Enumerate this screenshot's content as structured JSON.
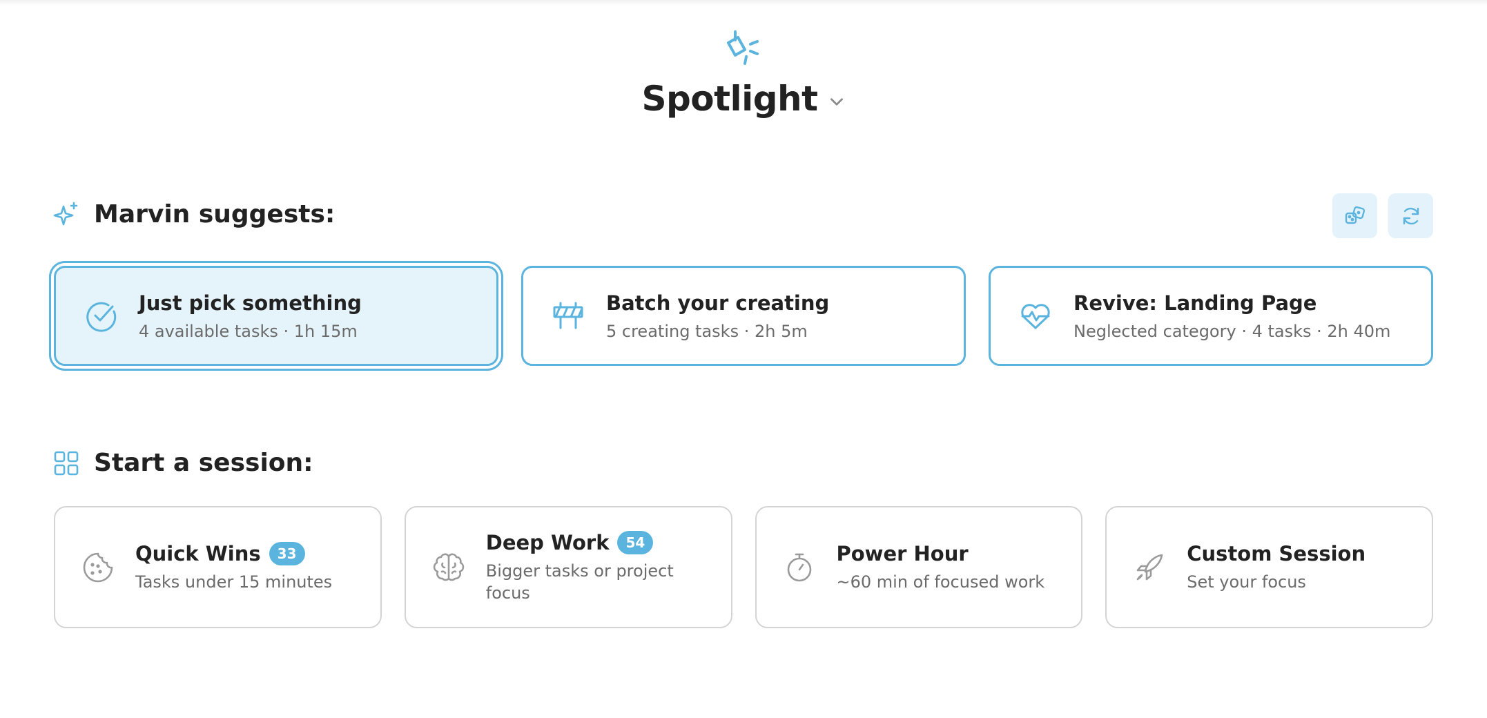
{
  "header": {
    "title": "Spotlight",
    "logo_icon": "spotlight-icon",
    "dropdown_icon": "chevron-down-icon"
  },
  "colors": {
    "accent": "#5ab4de",
    "accent_light": "#e5f3fa",
    "text": "#222222",
    "muted": "#6b6b6b",
    "border": "#d4d4d4"
  },
  "suggestions": {
    "heading": "Marvin suggests:",
    "heading_icon": "sparkles-icon",
    "tools": [
      "dice-icon",
      "refresh-icon"
    ],
    "cards": [
      {
        "title": "Just pick something",
        "subtitle": "4 available tasks · 1h 15m",
        "icon": "check-circle-icon",
        "selected": true
      },
      {
        "title": "Batch your creating",
        "subtitle": "5 creating tasks · 2h 5m",
        "icon": "barrier-icon",
        "selected": false
      },
      {
        "title": "Revive: Landing Page",
        "subtitle": "Neglected category · 4 tasks · 2h 40m",
        "icon": "heart-pulse-icon",
        "selected": false
      }
    ]
  },
  "sessions": {
    "heading": "Start a session:",
    "heading_icon": "grid-icon",
    "cards": [
      {
        "title": "Quick Wins",
        "badge": "33",
        "subtitle": "Tasks under 15 minutes",
        "icon": "cookie-icon"
      },
      {
        "title": "Deep Work",
        "badge": "54",
        "subtitle": "Bigger tasks or project focus",
        "icon": "brain-icon"
      },
      {
        "title": "Power Hour",
        "subtitle": "~60 min of focused work",
        "icon": "stopwatch-icon"
      },
      {
        "title": "Custom Session",
        "subtitle": "Set your focus",
        "icon": "rocket-icon"
      }
    ]
  }
}
